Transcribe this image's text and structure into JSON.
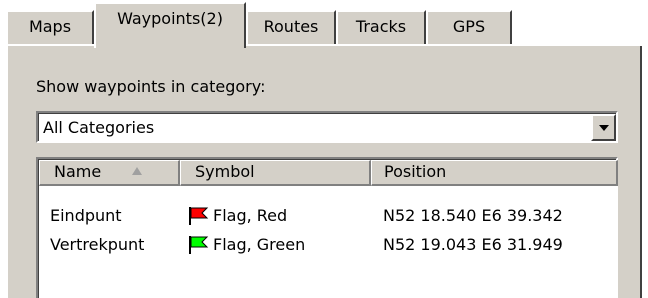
{
  "tabs": [
    {
      "label": "Maps"
    },
    {
      "label": "Waypoints(2)"
    },
    {
      "label": "Routes"
    },
    {
      "label": "Tracks"
    },
    {
      "label": "GPS"
    }
  ],
  "active_tab": "Waypoints(2)",
  "category": {
    "label": "Show waypoints in category:",
    "selected": "All Categories"
  },
  "table": {
    "columns": [
      "Name",
      "Symbol",
      "Position"
    ],
    "sort_column": "Name",
    "rows": [
      {
        "name": "Eindpunt",
        "symbol": "Flag, Red",
        "position": "N52 18.540 E6 39.342",
        "flag_color": "#ff0000"
      },
      {
        "name": "Vertrekpunt",
        "symbol": "Flag, Green",
        "position": "N52 19.043 E6 31.949",
        "flag_color": "#00ff00"
      }
    ]
  },
  "colors": {
    "panel_bg": "#d4d0c8",
    "window_bg": "#ffffff"
  }
}
